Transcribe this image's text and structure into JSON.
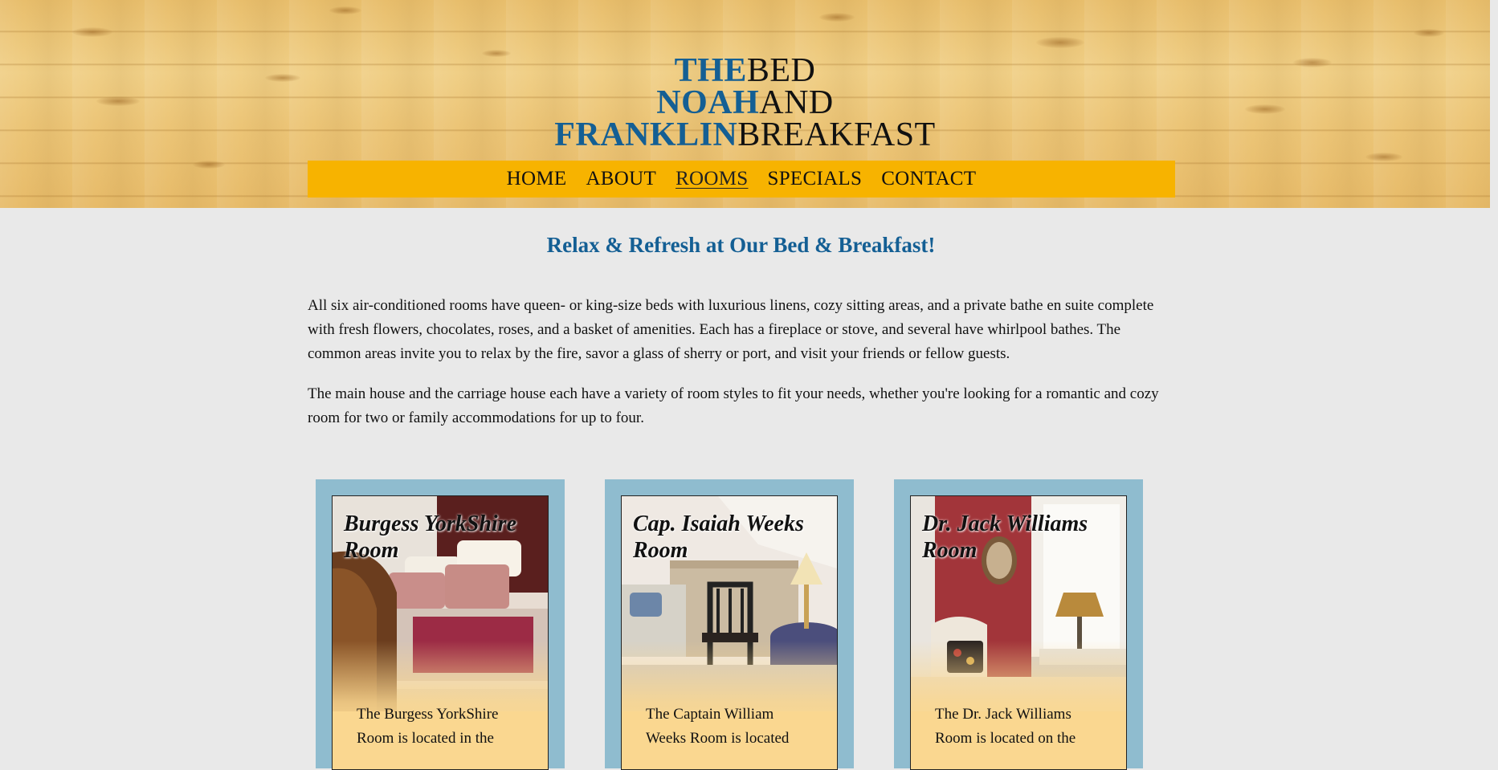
{
  "brand": {
    "line1_blue": "THE",
    "line1_black": "BED",
    "line2_blue": "NOAH",
    "line2_black": "AND",
    "line3_blue": "FRANKLIN",
    "line3_black": "BREAKFAST"
  },
  "nav": {
    "items": [
      {
        "label": "HOME"
      },
      {
        "label": "ABOUT"
      },
      {
        "label": "ROOMS"
      },
      {
        "label": "SPECIALS"
      },
      {
        "label": "CONTACT"
      }
    ],
    "active": "ROOMS"
  },
  "main": {
    "title": "Relax & Refresh at Our Bed & Breakfast!",
    "paragraph1": "All six air-conditioned rooms have queen- or king-size beds with luxurious linens, cozy sitting areas, and a private bathe en suite complete with fresh flowers, chocolates, roses, and a basket of amenities. Each has a fireplace or stove, and several have whirlpool bathes. The common areas invite you to relax by the fire, savor a glass of sherry or port, and visit your friends or fellow guests.",
    "paragraph2": "The main house and the carriage house each have a variety of room styles to fit your needs, whether you're looking for a romantic and cozy room for two or family accommodations for up to four."
  },
  "rooms": [
    {
      "title": "Burgess YorkShire Room",
      "text": "The Burgess YorkShire Room is located in the"
    },
    {
      "title": "Cap. Isaiah Weeks Room",
      "text": "The Captain William Weeks Room is located"
    },
    {
      "title": "Dr. Jack Williams Room",
      "text": "The Dr. Jack Williams Room is located on the"
    }
  ],
  "colors": {
    "brand_blue": "#145f94",
    "nav_yellow": "#f7b300",
    "card_frame": "#8fbccf",
    "card_fill": "#fad790"
  }
}
